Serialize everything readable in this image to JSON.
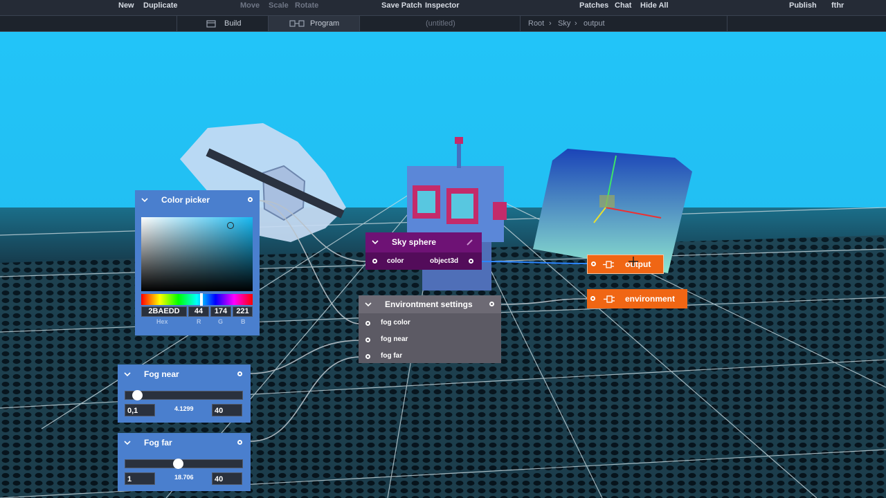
{
  "topbar": {
    "new": "New",
    "duplicate": "Duplicate",
    "move": "Move",
    "scale": "Scale",
    "rotate": "Rotate",
    "save_patch": "Save Patch",
    "inspector": "Inspector",
    "patches": "Patches",
    "chat": "Chat",
    "hide_all": "Hide All",
    "publish": "Publish",
    "user": "fthr"
  },
  "subbar": {
    "build": "Build",
    "program": "Program",
    "doc_title": "(untitled)",
    "breadcrumb": [
      "Root",
      "Sky",
      "output"
    ]
  },
  "color_picker": {
    "title": "Color picker",
    "hex": "2BAEDD",
    "r": "44",
    "g": "174",
    "b": "221",
    "labels": [
      "Hex",
      "R",
      "G",
      "B"
    ]
  },
  "sky_sphere": {
    "title": "Sky sphere",
    "input": "color",
    "output": "object3d"
  },
  "env_settings": {
    "title": "Environtment settings",
    "inputs": [
      "fog color",
      "fog near",
      "fog far"
    ]
  },
  "output_node": {
    "label": "output"
  },
  "environment_node": {
    "label": "environment"
  },
  "fog_near": {
    "title": "Fog near",
    "min": "0,1",
    "value": "4.1299",
    "max": "40",
    "level": 0.1
  },
  "fog_far": {
    "title": "Fog far",
    "min": "1",
    "value": "18.706",
    "max": "40",
    "level": 0.45
  },
  "colors": {
    "sky": "#26c3f5",
    "node_blue": "#4a7fce",
    "node_purple": "#6e1275",
    "node_grey": "#5c5a64",
    "node_orange": "#f06614",
    "topbar": "#252b36"
  }
}
